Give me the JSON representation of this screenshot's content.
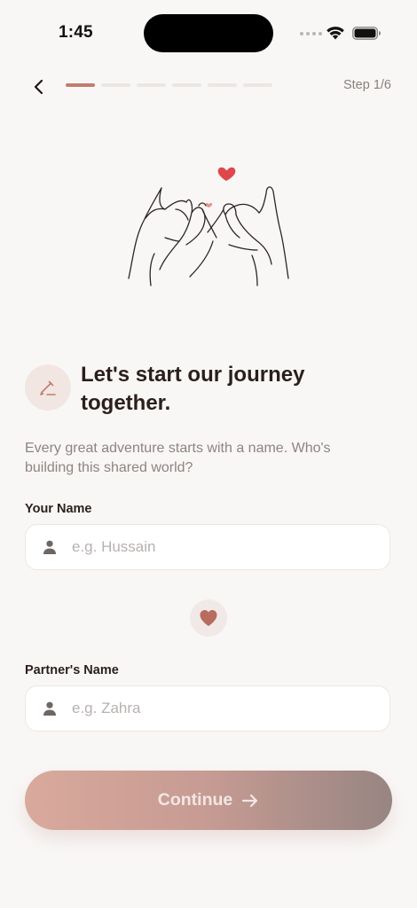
{
  "status_bar": {
    "time": "1:45"
  },
  "nav": {
    "step_label": "Step 1/6",
    "progress": {
      "total_steps": 6,
      "current_step": 1
    }
  },
  "intro": {
    "title": "Let's start our journey together.",
    "subtitle": "Every great adventure starts with a name. Who's building this shared world?"
  },
  "form": {
    "your_name": {
      "label": "Your Name",
      "placeholder": "e.g. Hussain",
      "value": ""
    },
    "partner_name": {
      "label": "Partner's Name",
      "placeholder": "e.g. Zahra",
      "value": ""
    }
  },
  "actions": {
    "continue_label": "Continue"
  },
  "colors": {
    "background": "#f9f7f6",
    "accent": "#c07d6d",
    "heart": "#e0474c",
    "button_gradient_start": "#d9a99c",
    "button_gradient_end": "#978582"
  },
  "icons": {
    "back": "chevron-left-icon",
    "title": "pencil-icon",
    "input": "person-icon",
    "divider": "heart-icon",
    "continue": "arrow-right-icon",
    "illustration": "pinky-promise-illustration"
  }
}
